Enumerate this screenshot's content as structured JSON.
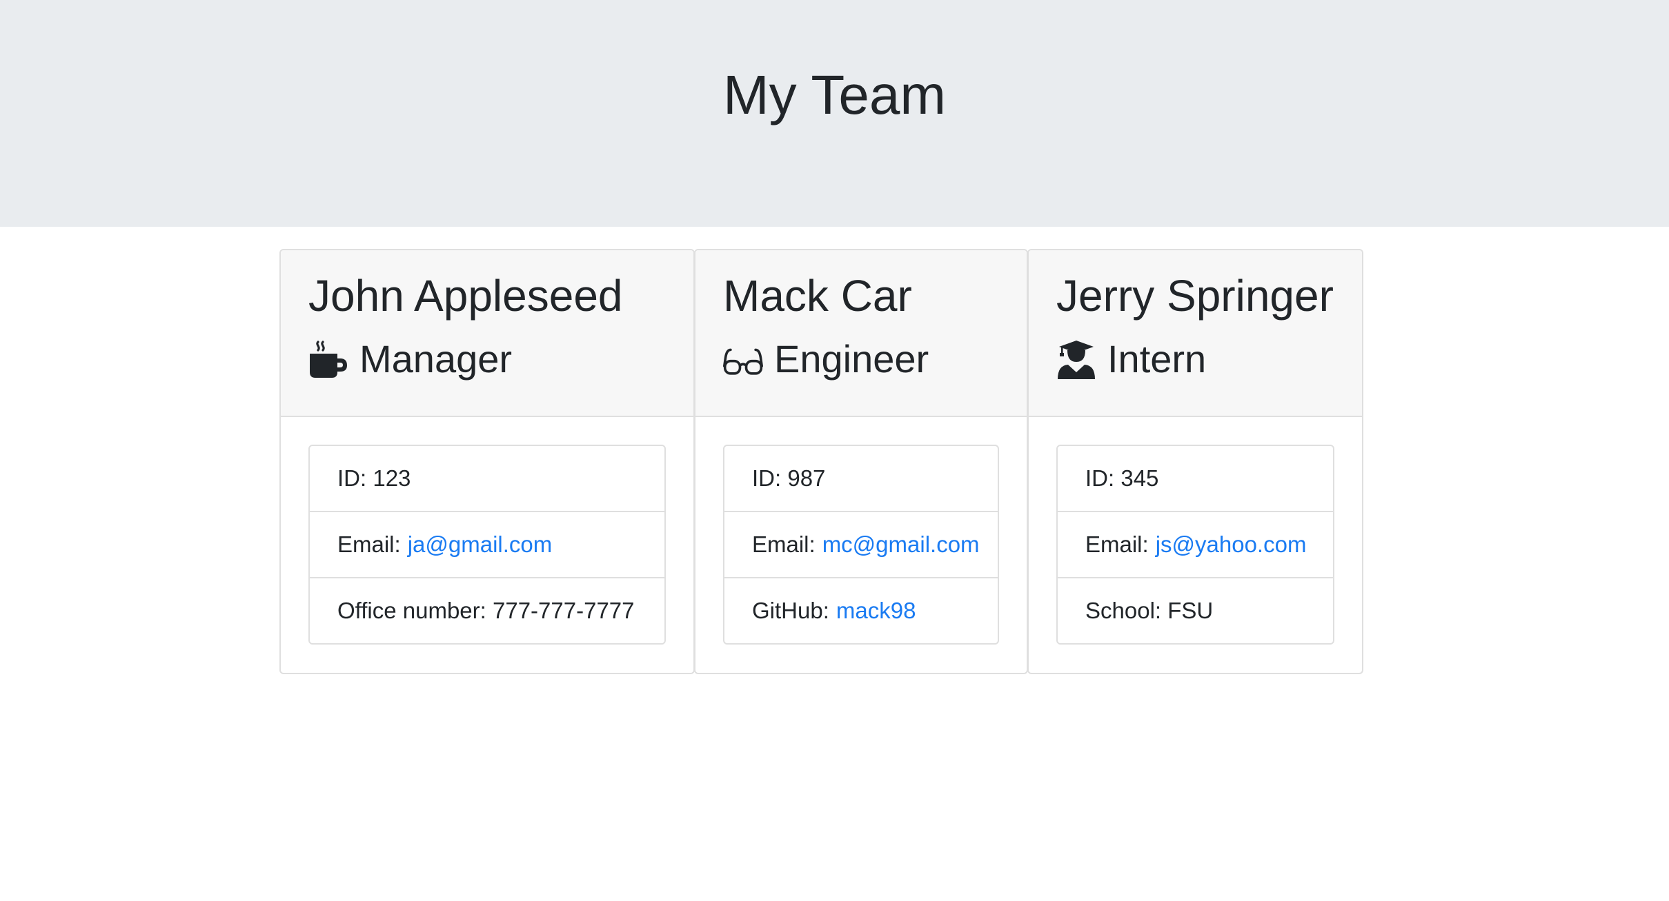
{
  "header": {
    "title": "My Team"
  },
  "colors": {
    "link": "#1a7bf2",
    "jumbotron_bg": "#e9ecef",
    "card_header_bg": "#f7f7f7"
  },
  "employees": [
    {
      "name": "John Appleseed",
      "role": "Manager",
      "role_icon": "mug-hot-icon",
      "id_label": "ID: 123",
      "email_label": "Email:",
      "email": "ja@gmail.com",
      "extra_label": "Office number: 777-777-7777"
    },
    {
      "name": "Mack Car",
      "role": "Engineer",
      "role_icon": "glasses-icon",
      "id_label": "ID: 987",
      "email_label": "Email:",
      "email": "mc@gmail.com",
      "extra_label": "GitHub:",
      "extra_link": "mack98"
    },
    {
      "name": "Jerry Springer",
      "role": "Intern",
      "role_icon": "user-graduate-icon",
      "id_label": "ID: 345",
      "email_label": "Email:",
      "email": "js@yahoo.com",
      "extra_label": "School: FSU"
    }
  ]
}
